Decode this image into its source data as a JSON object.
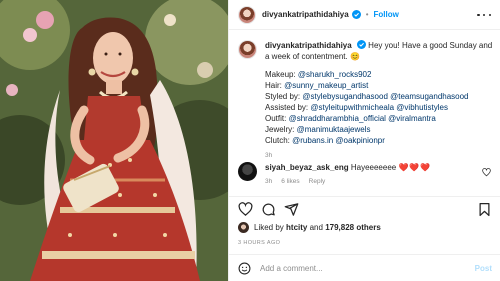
{
  "post": {
    "username": "divyankatripathidahiya",
    "follow_label": "Follow",
    "separator": "•"
  },
  "caption": {
    "username": "divyankatripathidahiya",
    "text": "Hey you! Have a good Sunday and a week of contentment.",
    "emoji": "😊",
    "credits": [
      {
        "label": "Makeup:",
        "mentions": "@sharukh_rocks902"
      },
      {
        "label": "Hair:",
        "mentions": "@sunny_makeup_artist"
      },
      {
        "label": "Styled by:",
        "mentions": "@stylebysugandhasood @teamsugandhasood"
      },
      {
        "label": "Assisted by:",
        "mentions": "@styleitupwithmicheala @vibhutistyles"
      },
      {
        "label": "Outfit:",
        "mentions": "@shraddharambhia_official @viralmantra"
      },
      {
        "label": "Jewelry:",
        "mentions": "@manimuktaajewels"
      },
      {
        "label": "Clutch:",
        "mentions": "@rubans.in @oakpinionpr"
      }
    ],
    "time": "3h"
  },
  "comment": {
    "username": "siyah_beyaz_ask_eng",
    "text": "Hayeeeeeee",
    "hearts": "❤️❤️❤️",
    "time": "3h",
    "likes": "6 likes",
    "reply": "Reply"
  },
  "likes": {
    "prefix": "Liked by",
    "user": "htcity",
    "and": "and",
    "count": "179,828 others"
  },
  "posted_ago": "3 HOURS AGO",
  "add_comment": {
    "placeholder": "Add a comment...",
    "post_label": "Post"
  },
  "colors": {
    "accent": "#0095f6",
    "link": "#00376b",
    "muted": "#8e8e8e",
    "heart": "#e0245e"
  },
  "icons": [
    "verified-badge-icon",
    "more-options-icon",
    "heart-icon",
    "comment-icon",
    "share-icon",
    "bookmark-icon",
    "emoji-icon"
  ]
}
